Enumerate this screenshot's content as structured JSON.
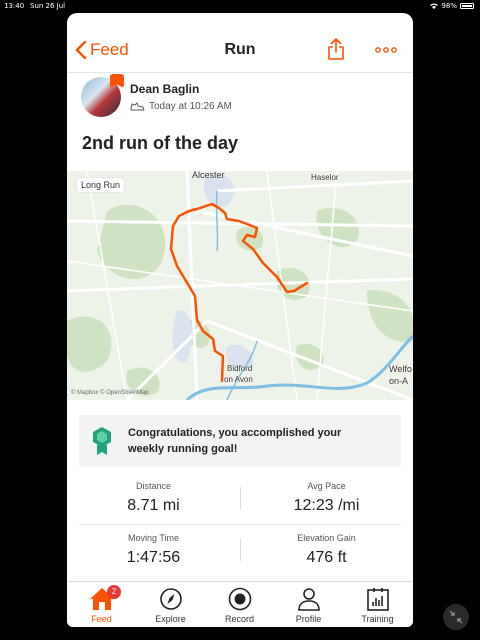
{
  "status_bar": {
    "time": "13:40",
    "date": "Sun 26 Jul",
    "battery": "98%"
  },
  "nav": {
    "back_label": "Feed",
    "title": "Run"
  },
  "athlete": {
    "name": "Dean Baglin",
    "timestamp": "Today at 10:26 AM"
  },
  "activity": {
    "title": "2nd run of the day"
  },
  "map": {
    "tag": "Long Run",
    "places": {
      "alcester": "Alcester",
      "haselor": "Haselor",
      "bidford_1": "Bidford",
      "bidford_2": "on Avon",
      "welford_1": "Welfo",
      "welford_2": "on-A"
    },
    "attribution": "© Mapbox © OpenStreetMap"
  },
  "goal": {
    "line1": "Congratulations, you accomplished your",
    "line2": "weekly running goal!"
  },
  "stats": {
    "distance": {
      "label": "Distance",
      "value": "8.71 mi"
    },
    "pace": {
      "label": "Avg Pace",
      "value": "12:23 /mi"
    },
    "moving_time": {
      "label": "Moving Time",
      "value": "1:47:56"
    },
    "elevation": {
      "label": "Elevation Gain",
      "value": "476 ft"
    }
  },
  "tabs": [
    {
      "label": "Feed",
      "icon": "home-icon",
      "badge": "2"
    },
    {
      "label": "Explore",
      "icon": "compass-icon"
    },
    {
      "label": "Record",
      "icon": "record-icon"
    },
    {
      "label": "Profile",
      "icon": "person-icon"
    },
    {
      "label": "Training",
      "icon": "chart-icon"
    }
  ],
  "colors": {
    "accent": "#fc5200",
    "route": "#fc5200",
    "goal_hex": "#1fa37a",
    "badge": "#e53935"
  }
}
